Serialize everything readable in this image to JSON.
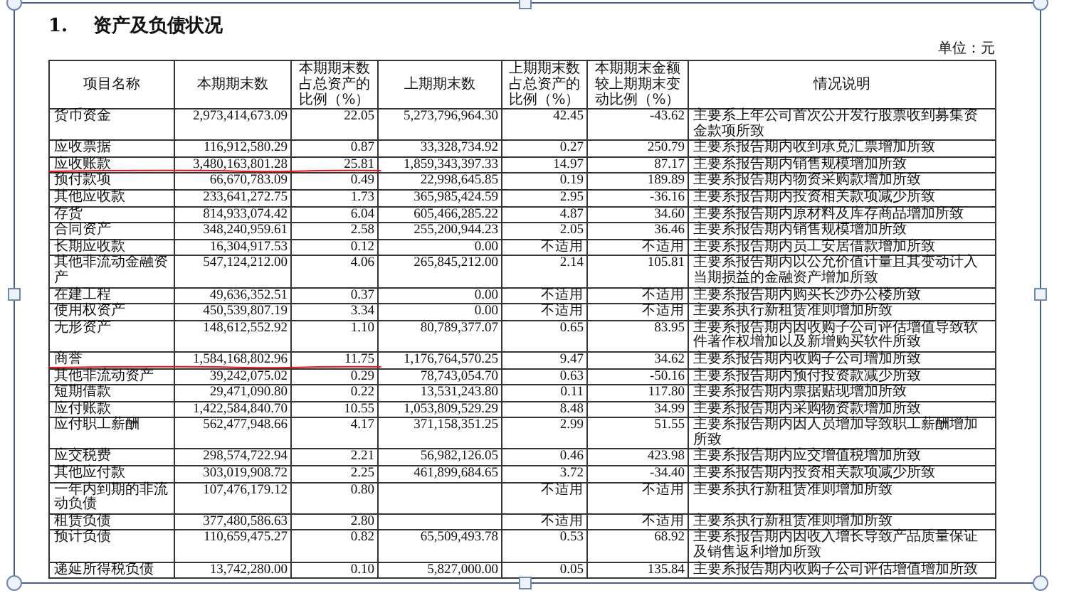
{
  "section_title": {
    "number": "1.",
    "text": "资产及负债状况"
  },
  "unit": "单位：元",
  "table": {
    "columns": [
      "项目名称",
      "本期期末数",
      "本期期末数占总资产的比例（%）",
      "上期期末数",
      "上期期末数占总资产的比例（%）",
      "本期期末金额较上期期末变动比例（%）",
      "情况说明"
    ],
    "rows": [
      {
        "name": "货币资金",
        "current": "2,973,414,673.09",
        "current_pct": "22.05",
        "previous": "5,273,796,964.30",
        "previous_pct": "42.45",
        "change": "-43.62",
        "note": "主要系上年公司首次公开发行股票收到募集资金款项所致",
        "underlined": false
      },
      {
        "name": "应收票据",
        "current": "116,912,580.29",
        "current_pct": "0.87",
        "previous": "33,328,734.92",
        "previous_pct": "0.27",
        "change": "250.79",
        "note": "主要系报告期内收到承兑汇票增加所致",
        "underlined": false
      },
      {
        "name": "应收账款",
        "current": "3,480,163,801.28",
        "current_pct": "25.81",
        "previous": "1,859,343,397.33",
        "previous_pct": "14.97",
        "change": "87.17",
        "note": "主要系报告期内销售规模增加所致",
        "underlined": true
      },
      {
        "name": "预付款项",
        "current": "66,670,783.09",
        "current_pct": "0.49",
        "previous": "22,998,645.85",
        "previous_pct": "0.19",
        "change": "189.89",
        "note": "主要系报告期内物资采购款增加所致",
        "underlined": false
      },
      {
        "name": "其他应收款",
        "current": "233,641,272.75",
        "current_pct": "1.73",
        "previous": "365,985,424.59",
        "previous_pct": "2.95",
        "change": "-36.16",
        "note": "主要系报告期内投资相关款项减少所致",
        "underlined": false
      },
      {
        "name": "存货",
        "current": "814,933,074.42",
        "current_pct": "6.04",
        "previous": "605,466,285.22",
        "previous_pct": "4.87",
        "change": "34.60",
        "note": "主要系报告期内原材料及库存商品增加所致",
        "underlined": false
      },
      {
        "name": "合同资产",
        "current": "348,240,959.61",
        "current_pct": "2.58",
        "previous": "255,200,944.23",
        "previous_pct": "2.05",
        "change": "36.46",
        "note": "主要系报告期内销售规模增加所致",
        "underlined": false
      },
      {
        "name": "长期应收款",
        "current": "16,304,917.53",
        "current_pct": "0.12",
        "previous": "0.00",
        "previous_pct": "不适用",
        "change": "不适用",
        "note": "主要系报告期内员工安居借款增加所致",
        "underlined": false
      },
      {
        "name": "其他非流动金融资产",
        "current": "547,124,212.00",
        "current_pct": "4.06",
        "previous": "265,845,212.00",
        "previous_pct": "2.14",
        "change": "105.81",
        "note": "主要系报告期内以公允价值计量且其变动计入当期损益的金融资产增加所致",
        "underlined": false
      },
      {
        "name": "在建工程",
        "current": "49,636,352.51",
        "current_pct": "0.37",
        "previous": "0.00",
        "previous_pct": "不适用",
        "change": "不适用",
        "note": "主要系报告期内购买长沙办公楼所致",
        "underlined": false
      },
      {
        "name": "使用权资产",
        "current": "450,539,807.19",
        "current_pct": "3.34",
        "previous": "0.00",
        "previous_pct": "不适用",
        "change": "不适用",
        "note": "主要系执行新租赁准则增加所致",
        "underlined": false
      },
      {
        "name": "无形资产",
        "current": "148,612,552.92",
        "current_pct": "1.10",
        "previous": "80,789,377.07",
        "previous_pct": "0.65",
        "change": "83.95",
        "note": "主要系报告期内因收购子公司评估增值导致软件著作权增加以及新增购买软件所致",
        "underlined": false
      },
      {
        "name": "商誉",
        "current": "1,584,168,802.96",
        "current_pct": "11.75",
        "previous": "1,176,764,570.25",
        "previous_pct": "9.47",
        "change": "34.62",
        "note": "主要系报告期内收购子公司增加所致",
        "underlined": true
      },
      {
        "name": "其他非流动资产",
        "current": "39,242,075.02",
        "current_pct": "0.29",
        "previous": "78,743,054.70",
        "previous_pct": "0.63",
        "change": "-50.16",
        "note": "主要系报告期内预付投资款减少所致",
        "underlined": false
      },
      {
        "name": "短期借款",
        "current": "29,471,090.80",
        "current_pct": "0.22",
        "previous": "13,531,243.80",
        "previous_pct": "0.11",
        "change": "117.80",
        "note": "主要系报告期内票据贴现增加所致",
        "underlined": false
      },
      {
        "name": "应付账款",
        "current": "1,422,584,840.70",
        "current_pct": "10.55",
        "previous": "1,053,809,529.29",
        "previous_pct": "8.48",
        "change": "34.99",
        "note": "主要系报告期内采购物资款增加所致",
        "underlined": false
      },
      {
        "name": "应付职工薪酬",
        "current": "562,477,948.66",
        "current_pct": "4.17",
        "previous": "371,158,351.25",
        "previous_pct": "2.99",
        "change": "51.55",
        "note": "主要系报告期内因人员增加导致职工薪酬增加所致",
        "underlined": false
      },
      {
        "name": "应交税费",
        "current": "298,574,722.94",
        "current_pct": "2.21",
        "previous": "56,982,126.05",
        "previous_pct": "0.46",
        "change": "423.98",
        "note": "主要系报告期内应交增值税增加所致",
        "underlined": false
      },
      {
        "name": "其他应付款",
        "current": "303,019,908.72",
        "current_pct": "2.25",
        "previous": "461,899,684.65",
        "previous_pct": "3.72",
        "change": "-34.40",
        "note": "主要系报告期内投资相关款项减少所致",
        "underlined": false
      },
      {
        "name": "一年内到期的非流动负债",
        "current": "107,476,179.12",
        "current_pct": "0.80",
        "previous_pct": "不适用",
        "change": "不适用",
        "note": "主要系执行新租赁准则增加所致",
        "underlined": false
      },
      {
        "name": "租赁负债",
        "current": "377,480,586.63",
        "current_pct": "2.80",
        "previous_pct": "不适用",
        "change": "不适用",
        "note": "主要系执行新租赁准则增加所致",
        "underlined": false
      },
      {
        "name": "预计负债",
        "current": "110,659,475.27",
        "current_pct": "0.82",
        "previous": "65,509,493.78",
        "previous_pct": "0.53",
        "change": "68.92",
        "note": "主要系报告期内因收入增长导致产品质量保证及销售返利增加所致",
        "underlined": false
      },
      {
        "name": "递延所得税负债",
        "current": "13,742,280.00",
        "current_pct": "0.10",
        "previous": "5,827,000.00",
        "previous_pct": "0.05",
        "change": "135.84",
        "note": "主要系报告期内收购子公司评估增值增加所致",
        "underlined": false
      }
    ]
  }
}
